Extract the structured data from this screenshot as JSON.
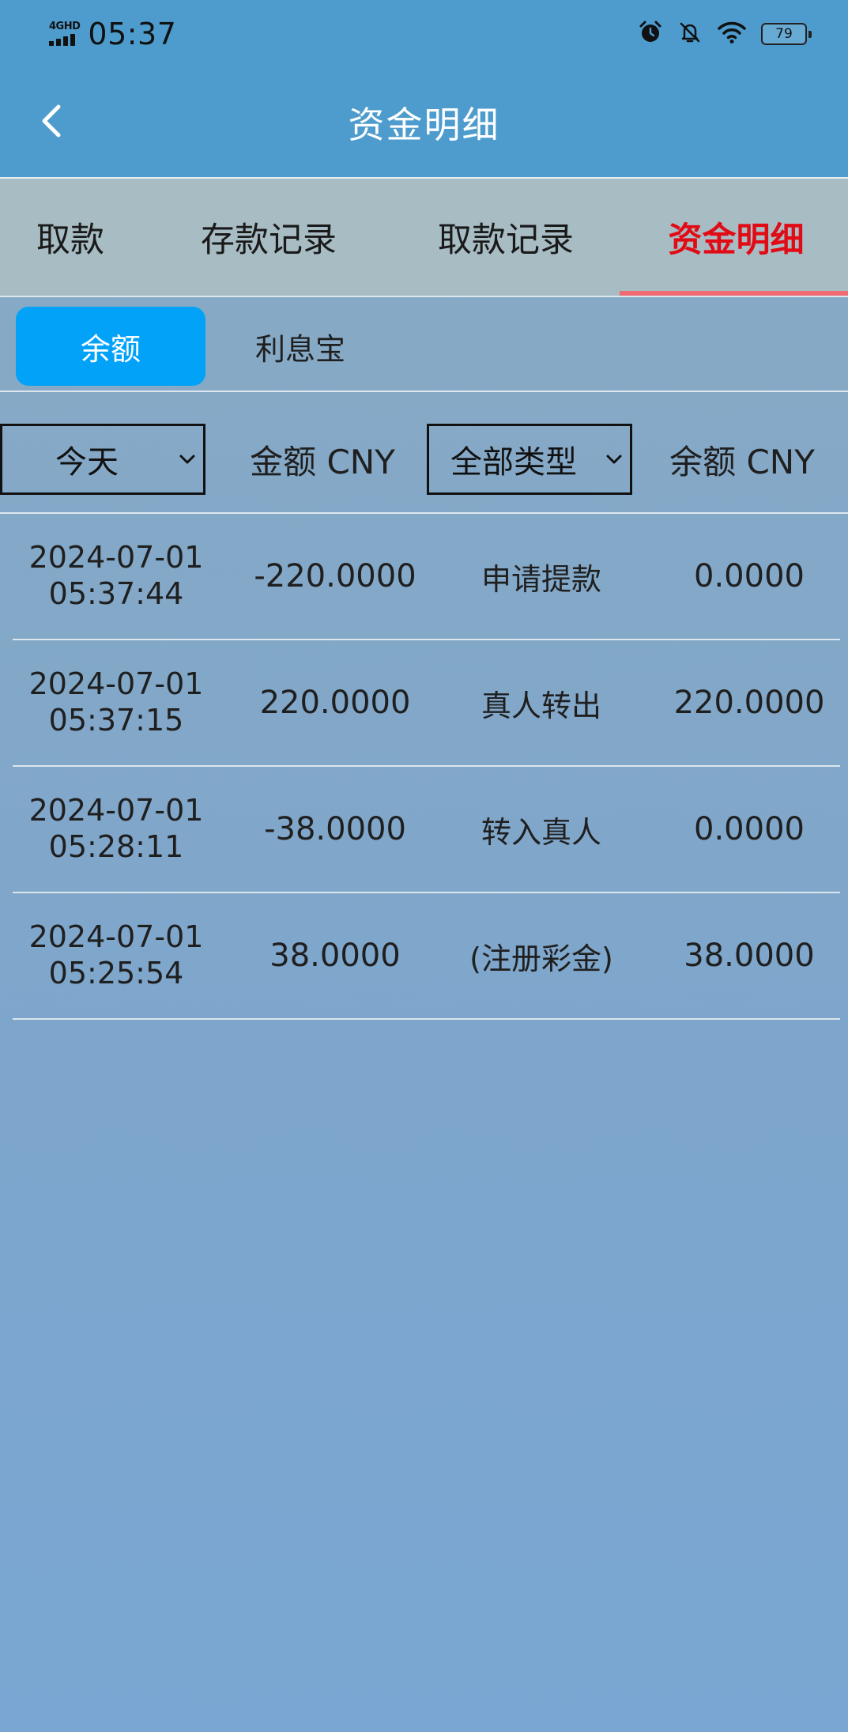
{
  "status_bar": {
    "network": "4GHD",
    "time": "05:37",
    "battery": "79"
  },
  "header": {
    "title": "资金明细"
  },
  "main_tabs": [
    {
      "label": "取款"
    },
    {
      "label": "存款记录"
    },
    {
      "label": "取款记录"
    },
    {
      "label": "资金明细",
      "active": true
    }
  ],
  "sub_tabs": [
    {
      "label": "余额",
      "active": true
    },
    {
      "label": "利息宝"
    }
  ],
  "filters": {
    "date_select": "今天",
    "amount_header": "金额 CNY",
    "type_select": "全部类型",
    "balance_header": "余额 CNY"
  },
  "records": [
    {
      "date": "2024-07-01",
      "time": "05:37:44",
      "amount": "-220.0000",
      "type": "申请提款",
      "balance": "0.0000"
    },
    {
      "date": "2024-07-01",
      "time": "05:37:15",
      "amount": "220.0000",
      "type": "真人转出",
      "balance": "220.0000"
    },
    {
      "date": "2024-07-01",
      "time": "05:28:11",
      "amount": "-38.0000",
      "type": "转入真人",
      "balance": "0.0000"
    },
    {
      "date": "2024-07-01",
      "time": "05:25:54",
      "amount": "38.0000",
      "type": "(注册彩金)",
      "balance": "38.0000"
    }
  ],
  "colors": {
    "header_bg": "#4d9ccd",
    "tabs_bg": "#a8bcc4",
    "active_tab_text": "#e10b15",
    "active_tab_underline": "#ee6b72",
    "active_subtab_bg": "#03a2f9"
  }
}
